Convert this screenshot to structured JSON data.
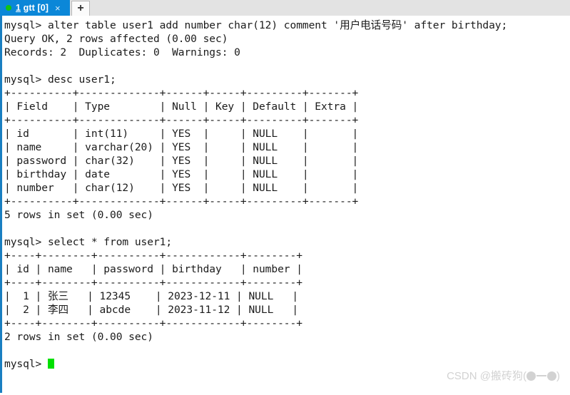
{
  "window": {
    "accent_color": "#0b87d8",
    "tabbar_bg": "#e3e3e3",
    "terminal_bg": "#ffffff",
    "terminal_fg": "#1b1b1b",
    "cursor_color": "#00e000",
    "status_dot_color": "#12c312"
  },
  "tabbar": {
    "tab": {
      "accel": "1",
      "label_rest": " gtt [0]",
      "full_label": "1 gtt [0]",
      "close_label": "×",
      "status_dot": "connected"
    },
    "new_tab_label": "+"
  },
  "terminal": {
    "prompt": "mysql>",
    "lines": [
      "mysql> alter table user1 add number char(12) comment '用户电话号码' after birthday;",
      "Query OK, 2 rows affected (0.00 sec)",
      "Records: 2  Duplicates: 0  Warnings: 0",
      "",
      "mysql> desc user1;",
      "+----------+-------------+------+-----+---------+-------+",
      "| Field    | Type        | Null | Key | Default | Extra |",
      "+----------+-------------+------+-----+---------+-------+",
      "| id       | int(11)     | YES  |     | NULL    |       |",
      "| name     | varchar(20) | YES  |     | NULL    |       |",
      "| password | char(32)    | YES  |     | NULL    |       |",
      "| birthday | date        | YES  |     | NULL    |       |",
      "| number   | char(12)    | YES  |     | NULL    |       |",
      "+----------+-------------+------+-----+---------+-------+",
      "5 rows in set (0.00 sec)",
      "",
      "mysql> select * from user1;",
      "+----+--------+----------+------------+--------+",
      "| id | name   | password | birthday   | number |",
      "+----+--------+----------+------------+--------+",
      "|  1 | 张三   | 12345    | 2023-12-11 | NULL   |",
      "|  2 | 李四   | abcde    | 2023-11-12 | NULL   |",
      "+----+--------+----------+------------+--------+",
      "2 rows in set (0.00 sec)",
      ""
    ],
    "final_prompt": "mysql> ",
    "commands": [
      "alter table user1 add number char(12) comment '用户电话号码' after birthday;",
      "desc user1;",
      "select * from user1;"
    ],
    "desc_table": {
      "headers": [
        "Field",
        "Type",
        "Null",
        "Key",
        "Default",
        "Extra"
      ],
      "rows": [
        [
          "id",
          "int(11)",
          "YES",
          "",
          "NULL",
          ""
        ],
        [
          "name",
          "varchar(20)",
          "YES",
          "",
          "NULL",
          ""
        ],
        [
          "password",
          "char(32)",
          "YES",
          "",
          "NULL",
          ""
        ],
        [
          "birthday",
          "date",
          "YES",
          "",
          "NULL",
          ""
        ],
        [
          "number",
          "char(12)",
          "YES",
          "",
          "NULL",
          ""
        ]
      ],
      "footer": "5 rows in set (0.00 sec)"
    },
    "select_table": {
      "headers": [
        "id",
        "name",
        "password",
        "birthday",
        "number"
      ],
      "rows": [
        [
          "1",
          "张三",
          "12345",
          "2023-12-11",
          "NULL"
        ],
        [
          "2",
          "李四",
          "abcde",
          "2023-11-12",
          "NULL"
        ]
      ],
      "footer": "2 rows in set (0.00 sec)"
    },
    "messages": [
      "Query OK, 2 rows affected (0.00 sec)",
      "Records: 2  Duplicates: 0  Warnings: 0"
    ]
  },
  "watermark": {
    "prefix": "CSDN @搬砖狗("
  }
}
